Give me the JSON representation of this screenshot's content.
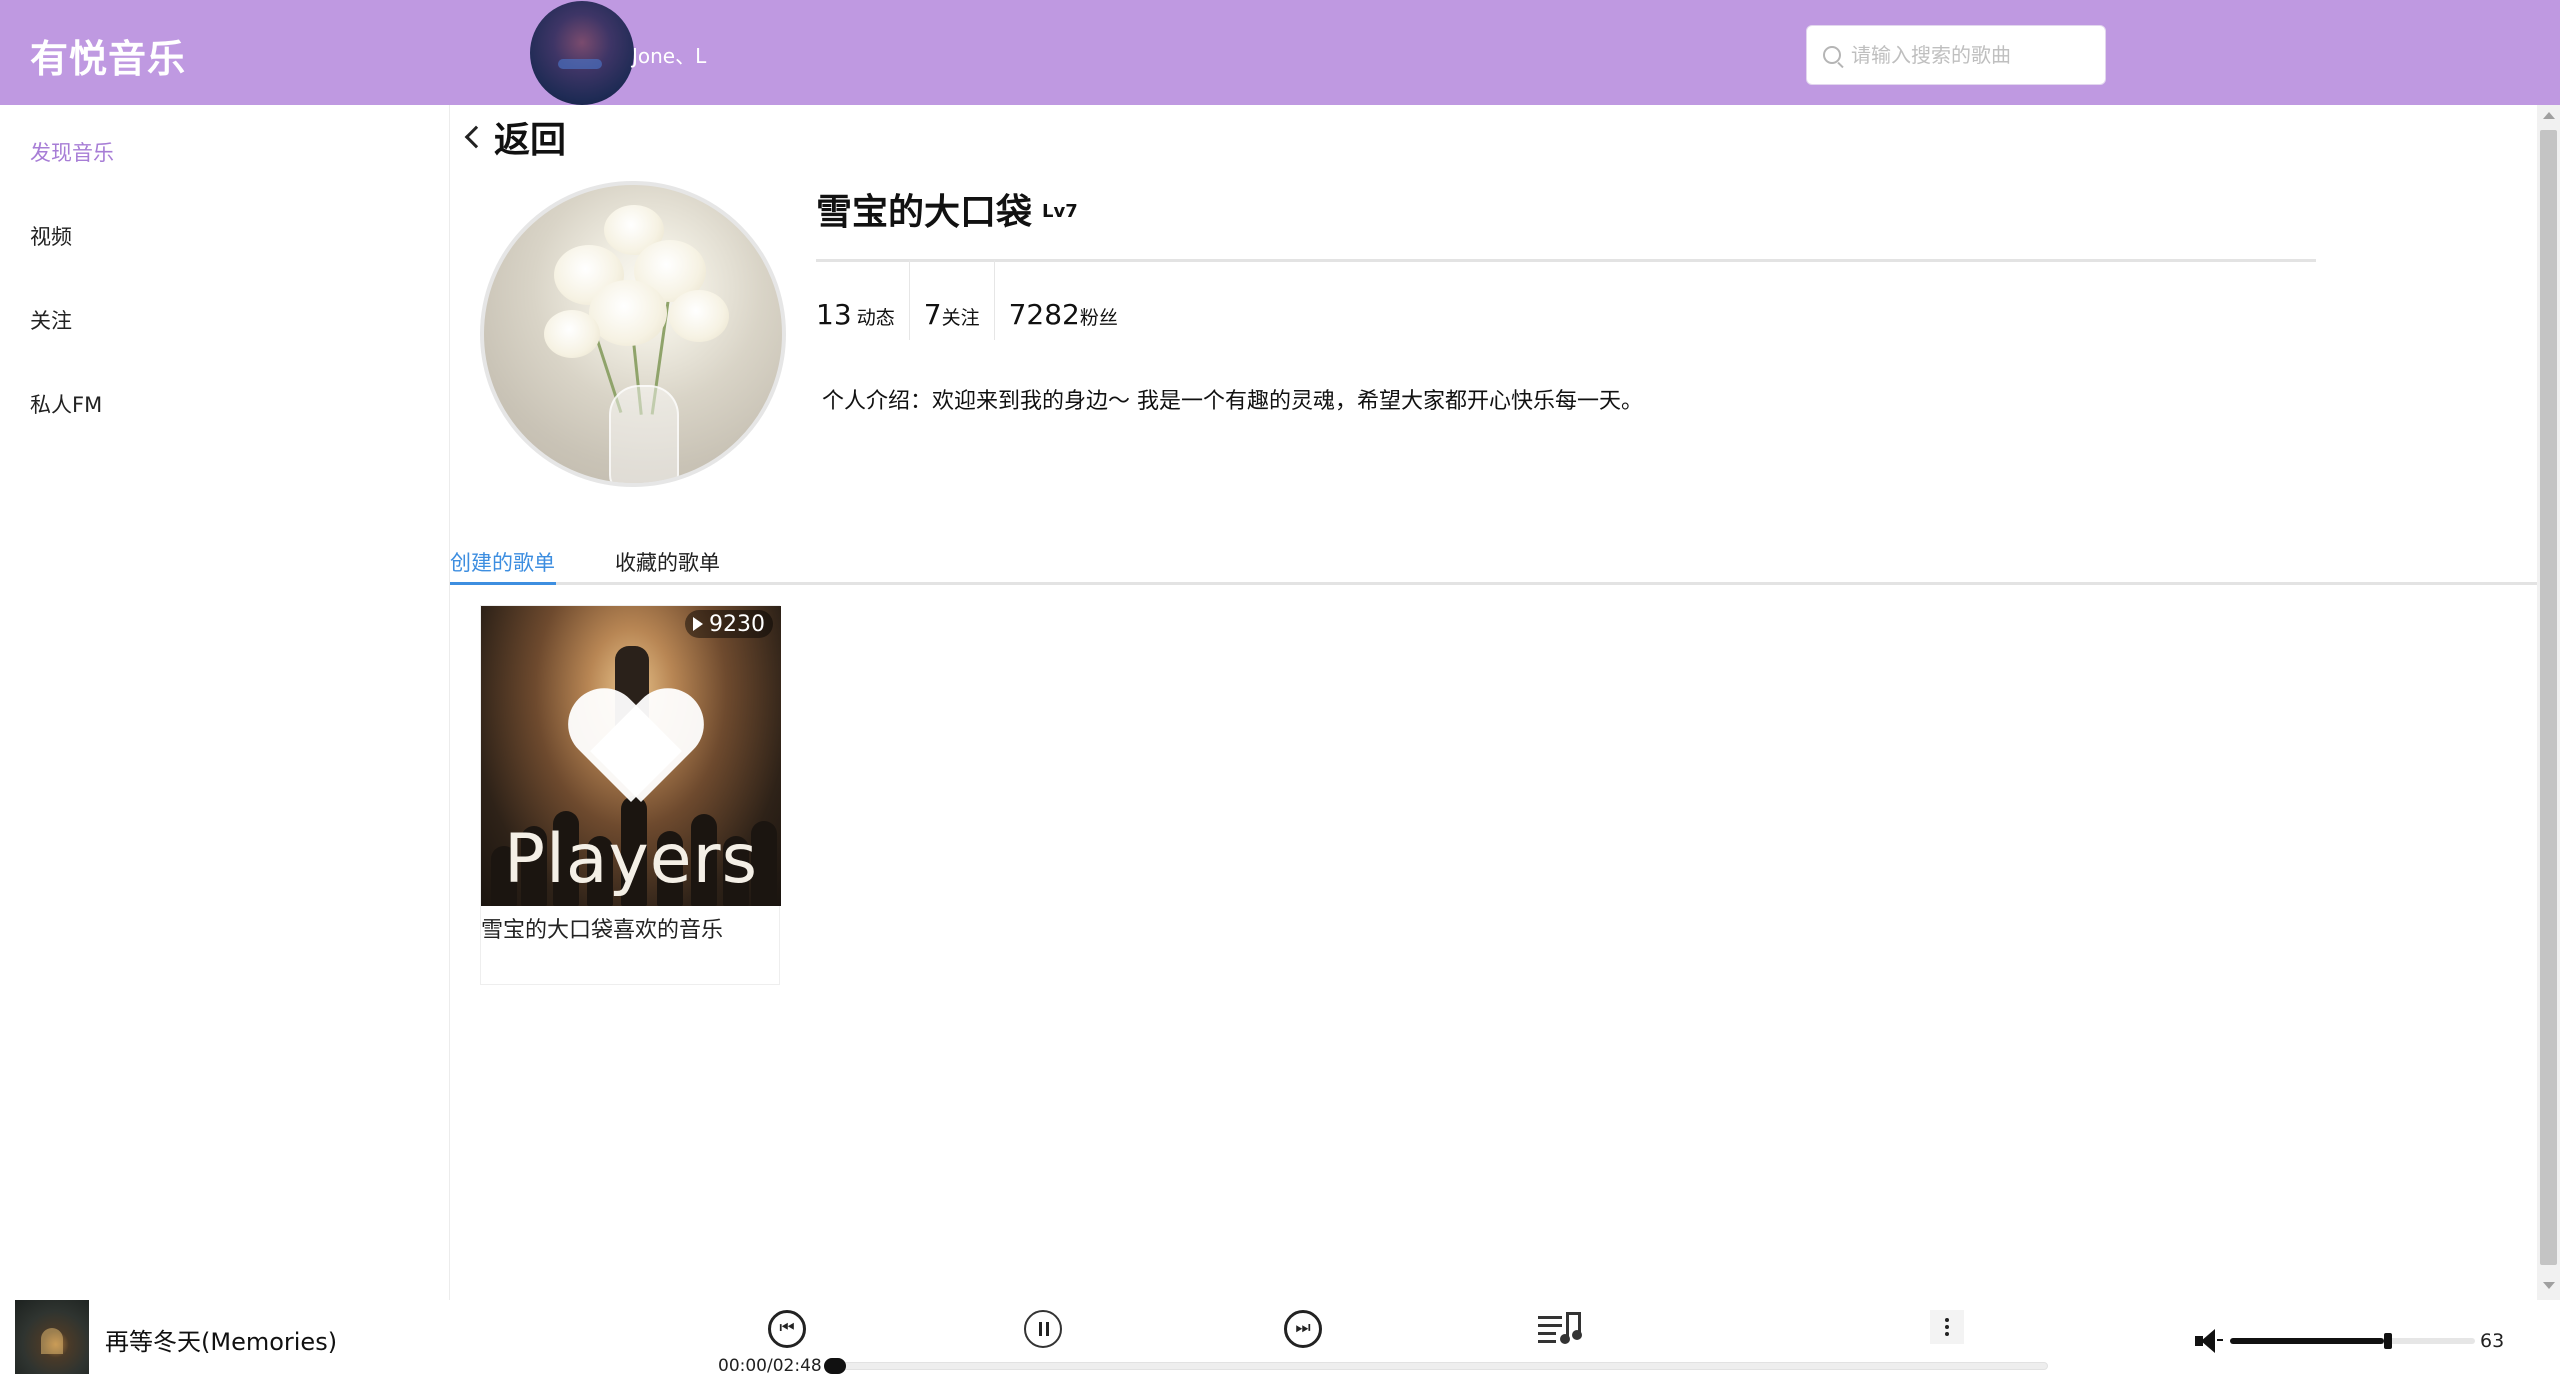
{
  "app": {
    "title": "有悦音乐"
  },
  "header": {
    "username": "Jone、L"
  },
  "search": {
    "placeholder": "请输入搜索的歌曲"
  },
  "sidebar": {
    "items": [
      {
        "label": "发现音乐"
      },
      {
        "label": "视频"
      },
      {
        "label": "关注"
      },
      {
        "label": "私人FM"
      }
    ]
  },
  "profile": {
    "back_label": "返回",
    "name": "雪宝的大口袋",
    "level": "Lv7",
    "stats": [
      {
        "num": "13",
        "label": "动态"
      },
      {
        "num": "7",
        "label": "关注"
      },
      {
        "num": "7282",
        "label": "粉丝"
      }
    ],
    "intro": "个人介绍：欢迎来到我的身边～ 我是一个有趣的灵魂，希望大家都开心快乐每一天。"
  },
  "tabs": [
    {
      "label": "创建的歌单"
    },
    {
      "label": "收藏的歌单"
    }
  ],
  "playlists": [
    {
      "cover_text": "Players",
      "play_count": "9230",
      "title": "雪宝的大口袋喜欢的音乐"
    }
  ],
  "player": {
    "song": "再等冬天(Memories)",
    "time": "00:00/02:48",
    "progress": 0.0,
    "volume": "63",
    "volume_fraction": 0.63,
    "icons": [
      "prev-icon",
      "pause-icon",
      "next-icon",
      "playlist-icon",
      "more-icon",
      "volume-icon"
    ]
  },
  "colors": {
    "header": "#bf99e1",
    "accent_sidebar": "#a77dd6",
    "accent_tab": "#3d8ee0"
  }
}
